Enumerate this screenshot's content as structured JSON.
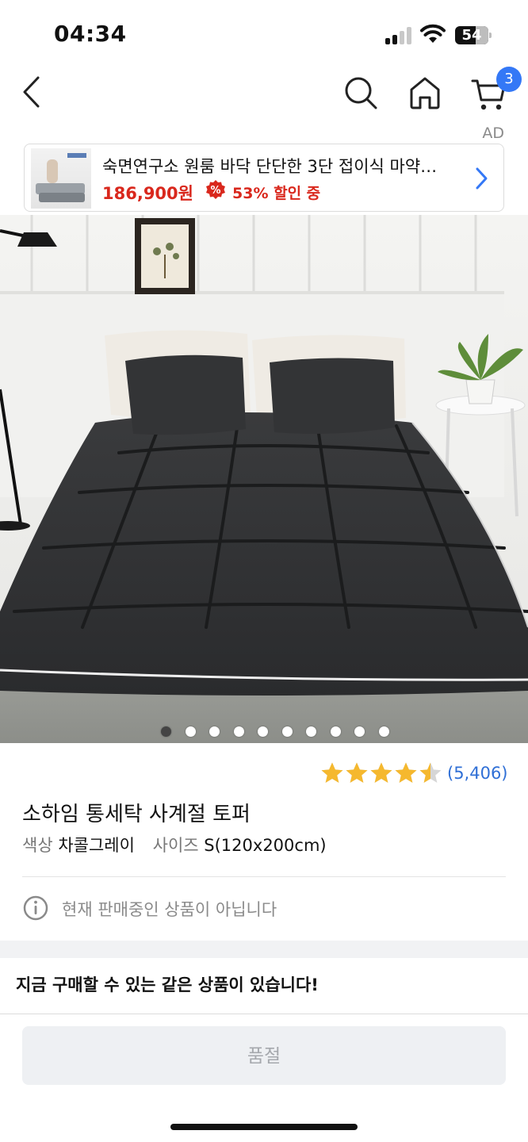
{
  "status_bar": {
    "time": "04:34",
    "battery": "54"
  },
  "nav": {
    "cart_count": "3"
  },
  "ad": {
    "label": "AD",
    "title": "숙면연구소 원룸 바닥 단단한 3단 접이식 마약…",
    "price": "186,900원",
    "discount": "53% 할인 중",
    "discount_icon": "%"
  },
  "carousel": {
    "total": 10,
    "active_index": 0
  },
  "product": {
    "rating": 4.5,
    "review_count": "(5,406)",
    "title": "소하임 통세탁 사계절 토퍼",
    "options": {
      "color_label": "색상",
      "color_value": "차콜그레이",
      "size_label": "사이즈",
      "size_value": "S(120x200cm)"
    },
    "status_text": "현재 판매중인 상품이 아닙니다",
    "same_product_text": "지금 구매할 수 있는 같은 상품이 있습니다!",
    "soldout_label": "품절"
  },
  "colors": {
    "accent_blue": "#3478f6",
    "price_red": "#d9281d",
    "star_yellow": "#f5b82e",
    "link_blue": "#2f6fd6"
  },
  "icons": [
    "back-icon",
    "search-icon",
    "home-icon",
    "cart-icon",
    "chevron-right-icon",
    "info-icon",
    "star-icon",
    "percent-badge-icon"
  ]
}
